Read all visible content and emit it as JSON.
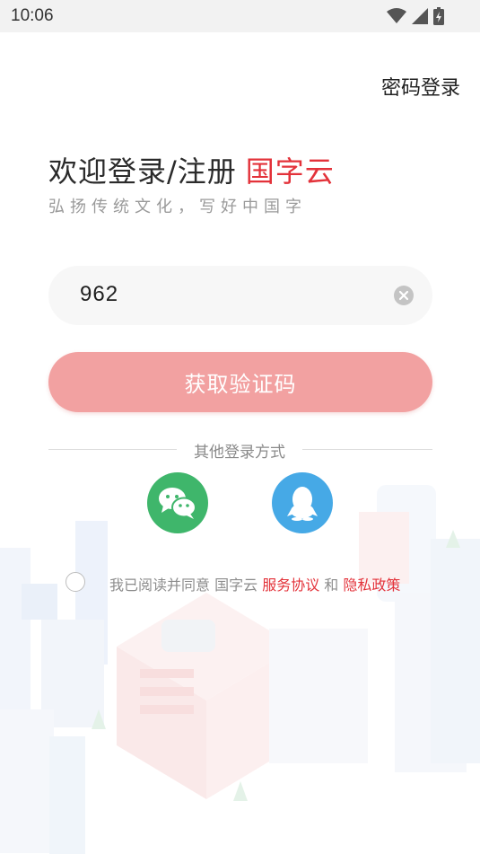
{
  "status_bar": {
    "time": "10:06"
  },
  "header": {
    "password_login": "密码登录"
  },
  "welcome": {
    "title": "欢迎登录/注册",
    "brand": "国字云",
    "slogan": "弘扬传统文化，写好中国字"
  },
  "phone": {
    "value": "962"
  },
  "buttons": {
    "get_code": "获取验证码"
  },
  "other_login": {
    "label": "其他登录方式",
    "providers": [
      {
        "name": "wechat",
        "icon": "wechat-icon",
        "color": "#3fb66b"
      },
      {
        "name": "qq",
        "icon": "qq-icon",
        "color": "#46a9e6"
      }
    ]
  },
  "agreement": {
    "prefix": "我已阅读并同意 国字云",
    "service": "服务协议",
    "and": "和",
    "privacy": "隐私政策",
    "checked": false
  },
  "colors": {
    "accent": "#e3323a",
    "button": "#f2a1a1"
  }
}
